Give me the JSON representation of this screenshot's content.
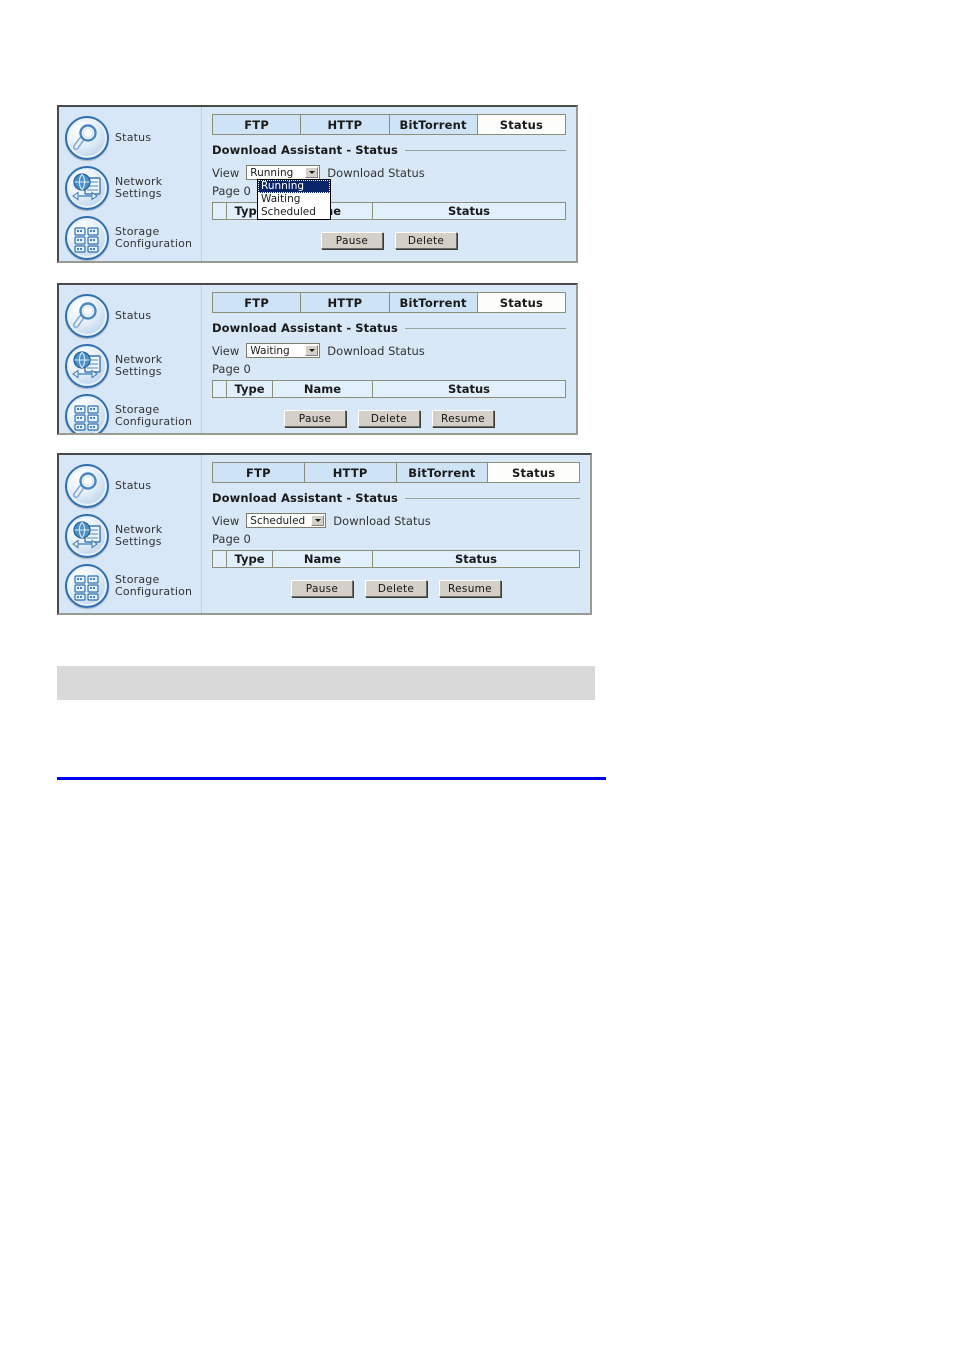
{
  "sidebar": {
    "items": [
      {
        "label": "Status",
        "icon": "magnifier-icon"
      },
      {
        "label": "Network\nSettings",
        "icon": "network-globe-server-icon"
      },
      {
        "label": "Storage\nConfiguration",
        "icon": "storage-grid-icon"
      }
    ]
  },
  "tabs": [
    {
      "label": "FTP",
      "active": false
    },
    {
      "label": "HTTP",
      "active": false
    },
    {
      "label": "BitTorrent",
      "active": false
    },
    {
      "label": "Status",
      "active": true
    }
  ],
  "section": {
    "title": "Download Assistant - Status"
  },
  "view": {
    "label": "View",
    "suffix": "Download Status",
    "options": [
      "Running",
      "Waiting",
      "Scheduled"
    ]
  },
  "page": {
    "text": "Page 0"
  },
  "table": {
    "headers": [
      "",
      "Type",
      "Name",
      "Status"
    ]
  },
  "panels": [
    {
      "name": "panel-running",
      "selected_view": "Running",
      "dropdown_open": true,
      "highlighted_option": "Running",
      "buttons": [
        "Pause",
        "Delete"
      ]
    },
    {
      "name": "panel-waiting",
      "selected_view": "Waiting",
      "dropdown_open": false,
      "highlighted_option": "",
      "buttons": [
        "Pause",
        "Delete",
        "Resume"
      ]
    },
    {
      "name": "panel-scheduled",
      "selected_view": "Scheduled",
      "dropdown_open": false,
      "highlighted_option": "",
      "buttons": [
        "Pause",
        "Delete",
        "Resume"
      ]
    }
  ],
  "colors": {
    "panel_background": "#d9e8f7",
    "active_tab": "#fdfdfb",
    "dropdown_highlight": "#0a246a",
    "gray_bar": "#d9d9d9",
    "blue_rule": "#0000ee",
    "icon_border": "#2f6fae"
  }
}
